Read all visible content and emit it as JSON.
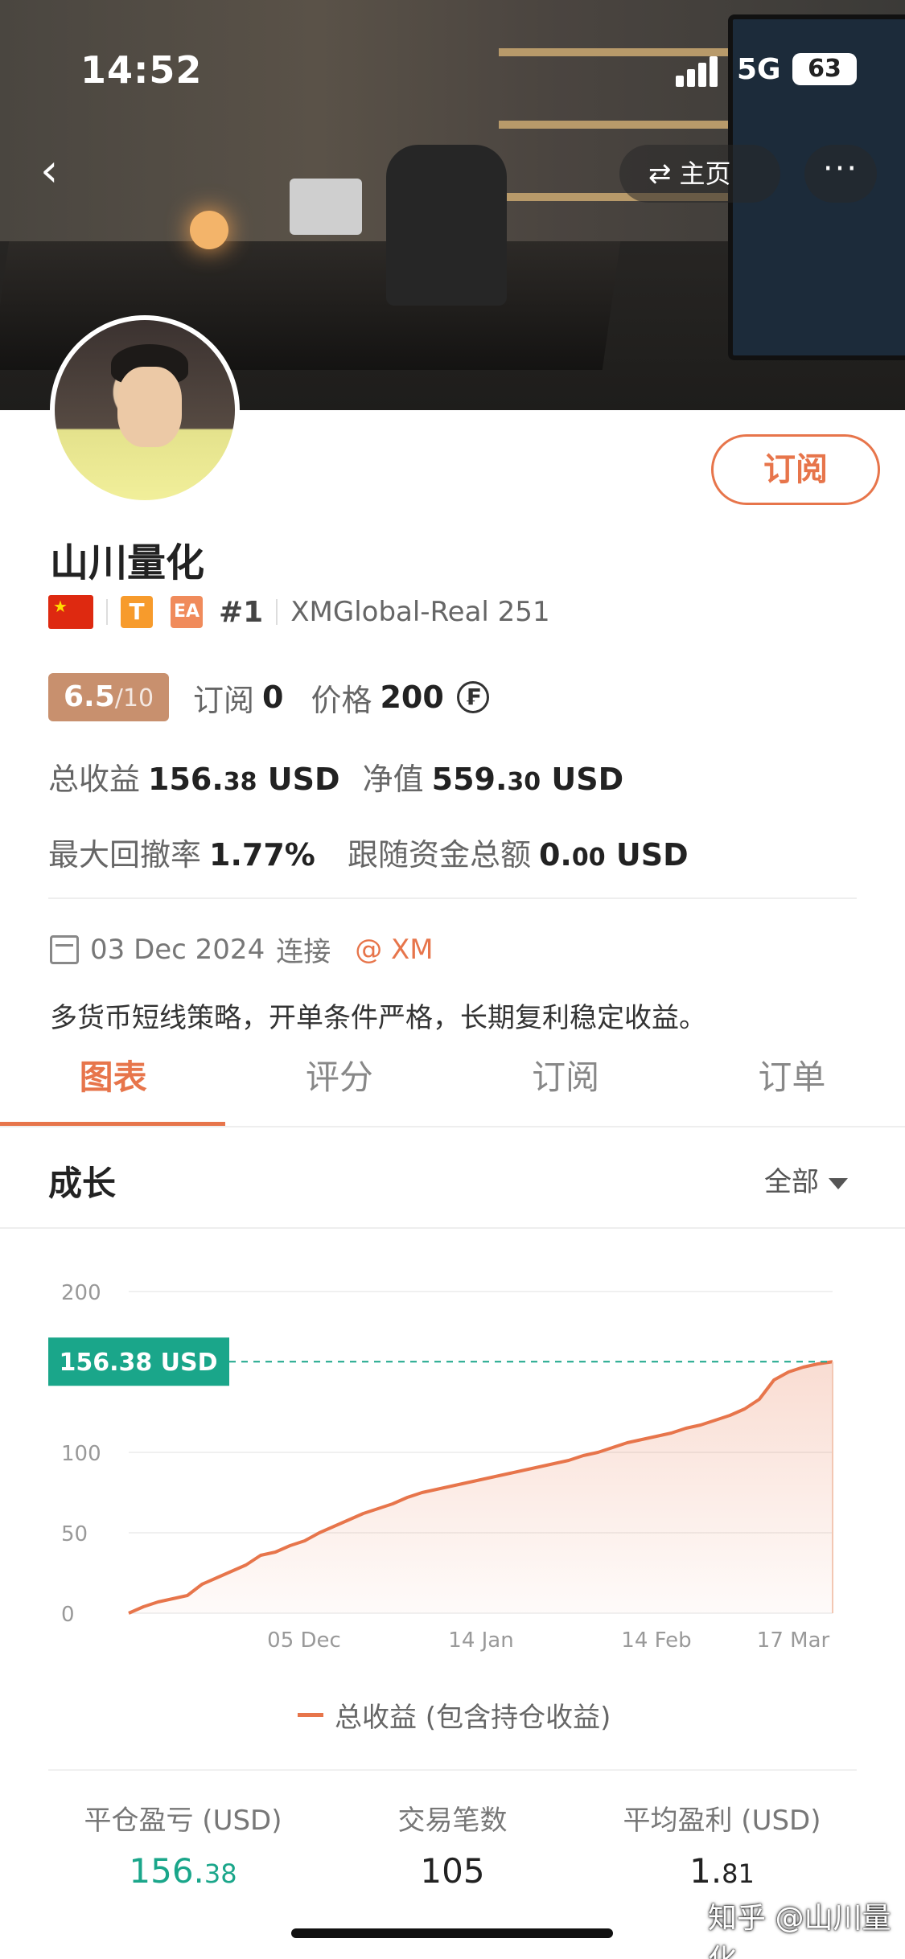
{
  "status_bar": {
    "time": "14:52",
    "network": "5G",
    "battery": "63"
  },
  "nav": {
    "home_label": "主页",
    "more": "···"
  },
  "profile": {
    "name": "山川量化",
    "subscribe_label": "订阅",
    "rank": "#1",
    "tier_badge": "T",
    "ea_badge": "EA",
    "account": "XMGlobal-Real 251",
    "score": "6.5",
    "score_max": "/10",
    "subscribers_label": "订阅",
    "subscribers": "0",
    "price_label": "价格",
    "price": "200",
    "total_profit_label": "总收益",
    "total_profit_int": "156.",
    "total_profit_dec": "38",
    "total_profit_unit": "USD",
    "equity_label": "净值",
    "equity_int": "559.",
    "equity_dec": "30",
    "equity_unit": "USD",
    "max_drawdown_label": "最大回撤率",
    "max_drawdown": "1.77%",
    "follow_funds_label": "跟随资金总额",
    "follow_funds_int": "0.",
    "follow_funds_dec": "00",
    "follow_funds_unit": "USD",
    "connected_date": "03 Dec 2024",
    "connected_label": "连接",
    "broker": "@ XM",
    "description": "多货币短线策略，开单条件严格，长期复利稳定收益。"
  },
  "tabs": [
    {
      "label": "图表",
      "active": true
    },
    {
      "label": "评分",
      "active": false
    },
    {
      "label": "订阅",
      "active": false
    },
    {
      "label": "订单",
      "active": false
    }
  ],
  "growth_section": {
    "title": "成长",
    "filter": "全部"
  },
  "chart_data": {
    "type": "area",
    "x_ticks": [
      "05 Dec",
      "14 Jan",
      "14 Feb",
      "17 Mar"
    ],
    "y_ticks": [
      0,
      50,
      100,
      200
    ],
    "ylim": [
      0,
      200
    ],
    "current_label": "156.38 USD",
    "current_value": 156.38,
    "legend": "总收益 (包含持仓收益)",
    "color": "#e7754b",
    "series": [
      {
        "name": "总收益 (包含持仓收益)",
        "values": [
          0,
          4,
          7,
          9,
          11,
          18,
          22,
          26,
          30,
          36,
          38,
          42,
          45,
          50,
          54,
          58,
          62,
          65,
          68,
          72,
          75,
          77,
          79,
          81,
          83,
          85,
          87,
          89,
          91,
          93,
          95,
          98,
          100,
          103,
          106,
          108,
          110,
          112,
          115,
          117,
          120,
          123,
          127,
          133,
          145,
          150,
          153,
          155,
          156.38
        ]
      }
    ]
  },
  "stats": [
    {
      "label": "平仓盈亏 (USD)",
      "int": "156.",
      "dec": "38",
      "highlight": true
    },
    {
      "label": "交易笔数",
      "int": "105",
      "dec": "",
      "highlight": false
    },
    {
      "label": "平均盈利 (USD)",
      "int": "1.",
      "dec": "81",
      "highlight": false
    }
  ],
  "watermark": "知乎 @山川量化"
}
